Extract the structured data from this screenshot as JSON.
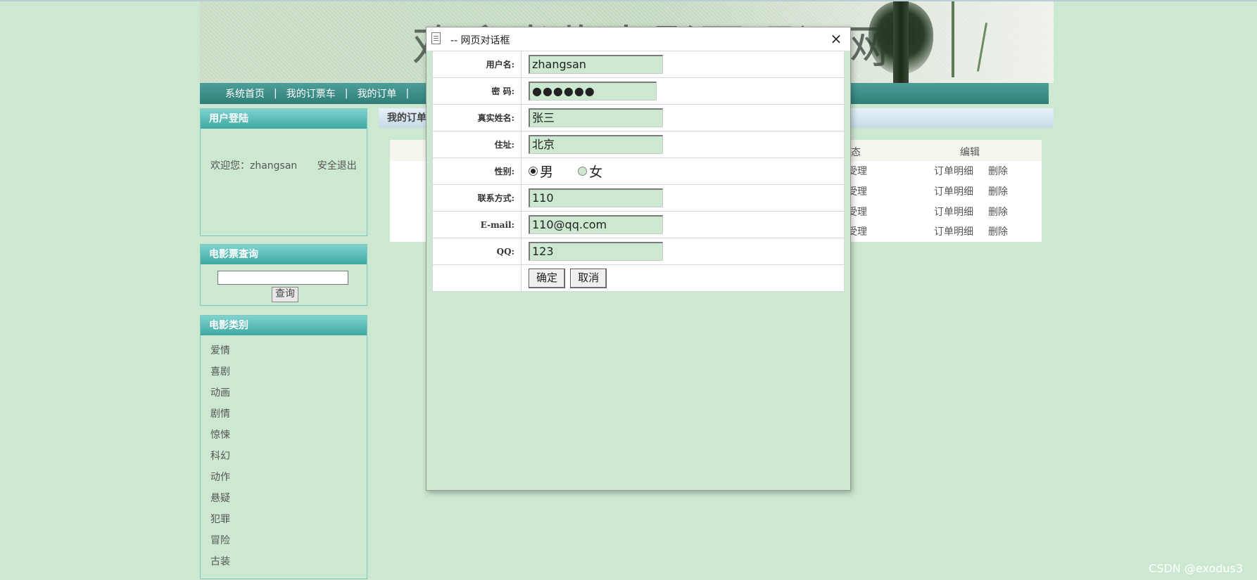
{
  "banner": {
    "title": "欢迎光临电影票预订网"
  },
  "nav": {
    "items": [
      "系统首页",
      "我的订票车",
      "我的订单"
    ],
    "separator": "|"
  },
  "login_panel": {
    "title": "用户登陆",
    "welcome": "欢迎您：zhangsan",
    "logout": "安全退出"
  },
  "search_panel": {
    "title": "电影票查询",
    "input_value": "",
    "button": "查询"
  },
  "category_panel": {
    "title": "电影类别",
    "items": [
      "爱情",
      "喜剧",
      "动画",
      "剧情",
      "惊悚",
      "科幻",
      "动作",
      "悬疑",
      "犯罪",
      "冒险",
      "古装"
    ]
  },
  "content": {
    "title": "我的订单",
    "table": {
      "headers": {
        "status": "态",
        "edit": "编辑"
      },
      "rows": [
        {
          "status": "受理",
          "detail": "订单明细",
          "delete": "删除"
        },
        {
          "status": "受理",
          "detail": "订单明细",
          "delete": "删除"
        },
        {
          "status": "受理",
          "detail": "订单明细",
          "delete": "删除"
        },
        {
          "status": "受理",
          "detail": "订单明细",
          "delete": "删除"
        }
      ]
    }
  },
  "dialog": {
    "title": "-- 网页对话框",
    "close": "×",
    "fields": {
      "username": {
        "label": "用户名:",
        "value": "zhangsan"
      },
      "password": {
        "label": "密 码:",
        "value": "●●●●●●"
      },
      "realname": {
        "label": "真实姓名:",
        "value": "张三"
      },
      "address": {
        "label": "住址:",
        "value": "北京"
      },
      "gender": {
        "label": "性别:",
        "options": [
          "男",
          "女"
        ],
        "selected": "男"
      },
      "phone": {
        "label": "联系方式:",
        "value": "110"
      },
      "email": {
        "label": "E-mail:",
        "value": "110@qq.com"
      },
      "qq": {
        "label": "QQ:",
        "value": "123"
      }
    },
    "buttons": {
      "ok": "确定",
      "cancel": "取消"
    }
  },
  "watermark": "CSDN @exodus3",
  "colors": {
    "page_bg": "#cde8d0",
    "nav_bg": "#2f7f78",
    "panel_head": "#3ea8a2"
  }
}
